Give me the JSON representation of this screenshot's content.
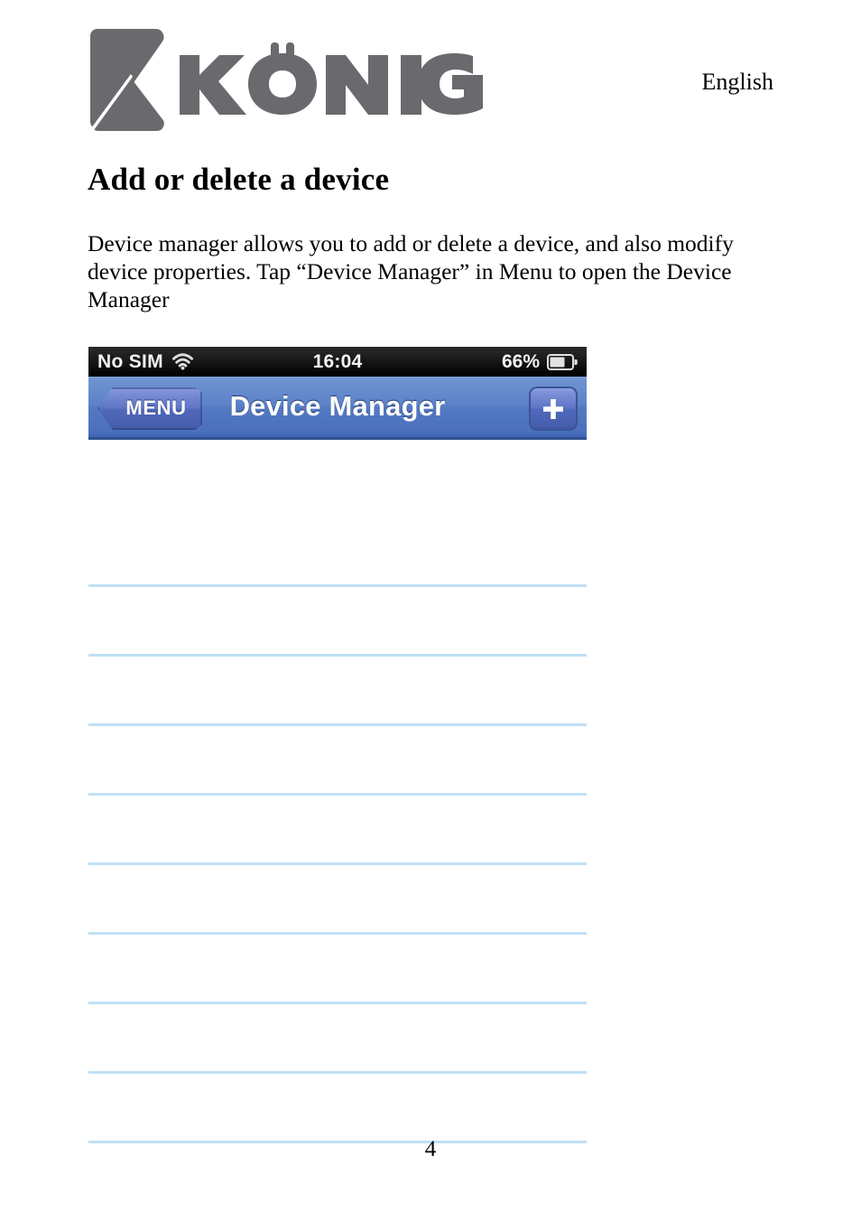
{
  "document": {
    "language_label": "English",
    "title": "Add or delete a device",
    "body_text": "Device manager allows you to add or delete a device, and also modify device properties. Tap “Device Manager” in Menu to open the Device Manager",
    "page_number": "4",
    "brand": {
      "name": "KÖNIG",
      "logo_mark": "konig-k-logo",
      "logo_color": "#6a696d"
    }
  },
  "screenshot": {
    "status_bar": {
      "carrier": "No SIM",
      "wifi_icon": "wifi-icon",
      "time": "16:04",
      "battery_percent": "66%",
      "battery_icon": "battery-icon",
      "battery_level": 66,
      "background_color": "#0d0d0d",
      "text_color": "#f2f2f2"
    },
    "nav_bar": {
      "back_button_label": "MENU",
      "title": "Device Manager",
      "add_button_icon": "plus-icon",
      "accent_color": "#5b81c8",
      "title_color": "#ffffff"
    },
    "device_list": {
      "separator_color": "#bfe0f5",
      "background_color": "#ffffff",
      "rows": [
        {
          "label": ""
        },
        {
          "label": ""
        },
        {
          "label": ""
        },
        {
          "label": ""
        },
        {
          "label": ""
        },
        {
          "label": ""
        },
        {
          "label": ""
        },
        {
          "label": ""
        },
        {
          "label": ""
        }
      ]
    }
  }
}
